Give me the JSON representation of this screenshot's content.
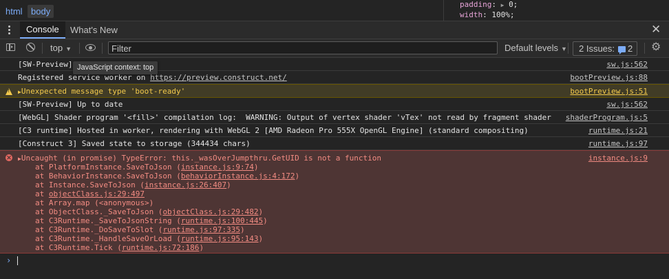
{
  "breadcrumb": {
    "html": "html",
    "body": "body"
  },
  "styles": {
    "line1_prop": "padding",
    "line1_val": "0;",
    "line2_prop": "width",
    "line2_val": "100%;"
  },
  "tabs": {
    "console": "Console",
    "whats_new": "What's New"
  },
  "toolbar": {
    "context": "top",
    "filter_placeholder": "Filter",
    "levels": "Default levels",
    "issues_label": "2 Issues:",
    "issues_count": "2"
  },
  "tooltip": "JavaScript context: top",
  "messages": [
    {
      "text": "[SW-Preview] ",
      "source": "sw.js:562"
    },
    {
      "text_prefix": "Registered service worker on ",
      "text_link": "https://preview.construct.net/",
      "source": "bootPreview.js:88"
    },
    {
      "text": "Unexpected message type 'boot-ready'",
      "source": "bootPreview.js:51",
      "level": "warning"
    },
    {
      "text": "[SW-Preview] Up to date",
      "source": "sw.js:562"
    },
    {
      "text": "[WebGL] Shader program '<fill>' compilation log:  WARNING: Output of vertex shader 'vTex' not read by fragment shader",
      "source": "shaderProgram.js:5"
    },
    {
      "text": "[C3 runtime] Hosted in worker, rendering with WebGL 2 [AMD Radeon Pro 555X OpenGL Engine] (standard compositing)",
      "source": "runtime.js:21"
    },
    {
      "text": "[Construct 3] Saved state to storage (344434 chars)",
      "source": "runtime.js:97"
    }
  ],
  "error": {
    "text": "Uncaught (in promise) TypeError: this._wasOverJumpthru.GetUID is not a function",
    "source": "instance.js:9",
    "stack": [
      {
        "prefix": "at PlatformInstance.SaveToJson (",
        "link": "instance.js:9:74",
        "suffix": ")"
      },
      {
        "prefix": "at BehaviorInstance.SaveToJson (",
        "link": "behaviorInstance.js:4:172",
        "suffix": ")"
      },
      {
        "prefix": "at Instance.SaveToJson (",
        "link": "instance.js:26:407",
        "suffix": ")"
      },
      {
        "prefix": "at ",
        "link": "objectClass.js:29:497",
        "suffix": ""
      },
      {
        "prefix": "at Array.map (<anonymous>)",
        "link": "",
        "suffix": ""
      },
      {
        "prefix": "at ObjectClass._SaveToJson (",
        "link": "objectClass.js:29:482",
        "suffix": ")"
      },
      {
        "prefix": "at C3Runtime._SaveToJsonString (",
        "link": "runtime.js:100:445",
        "suffix": ")"
      },
      {
        "prefix": "at C3Runtime._DoSaveToSlot (",
        "link": "runtime.js:97:335",
        "suffix": ")"
      },
      {
        "prefix": "at C3Runtime._HandleSaveOrLoad (",
        "link": "runtime.js:95:143",
        "suffix": ")"
      },
      {
        "prefix": "at C3Runtime.Tick (",
        "link": "runtime.js:72:186",
        "suffix": ")"
      }
    ]
  },
  "colors": {
    "background": "#242424",
    "accent": "#7cacf8",
    "warning": "#f2c94c",
    "error": "#f28b82"
  }
}
